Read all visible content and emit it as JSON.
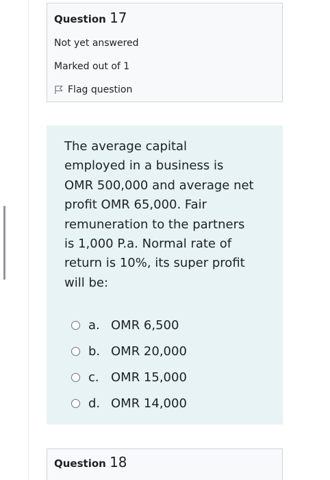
{
  "question_info": {
    "label": "Question",
    "number": "17",
    "status": "Not yet answered",
    "marks": "Marked out of 1",
    "flag_label": "Flag question"
  },
  "question": {
    "text": "The average capital employed in a business is OMR 500,000 and average net profit OMR 65,000. Fair remuneration to the partners is 1,000 P.a. Normal rate of return is 10%, its super profit will be:",
    "lines": [
      "The average capital",
      "employed in a business is",
      "OMR 500,000 and average net",
      "profit OMR 65,000. Fair",
      "remuneration to the partners",
      "is 1,000 P.a. Normal rate of",
      "return is 10%, its super profit",
      "will be:"
    ],
    "answers": [
      {
        "letter": "a.",
        "text": "OMR 6,500"
      },
      {
        "letter": "b.",
        "text": "OMR 20,000"
      },
      {
        "letter": "c.",
        "text": "OMR 15,000"
      },
      {
        "letter": "d.",
        "text": "OMR 14,000"
      }
    ]
  },
  "next_question": {
    "label": "Question",
    "number": "18"
  },
  "icons": {
    "flag": "flag-icon",
    "radio": "radio-unchecked-icon"
  },
  "colors": {
    "info_background": "#f8f9fa",
    "content_background": "#e7f3f5",
    "border": "#cfd3d7",
    "text": "#1d2125"
  }
}
